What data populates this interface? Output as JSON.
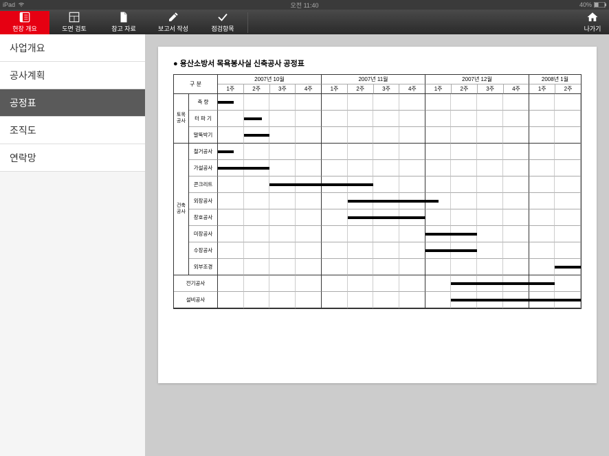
{
  "status": {
    "device": "iPad",
    "time": "오전 11:40",
    "battery": "40%"
  },
  "toolbar": {
    "items": [
      {
        "label": "현장 개요",
        "active": true
      },
      {
        "label": "도면 검토",
        "active": false
      },
      {
        "label": "참고 자료",
        "active": false
      },
      {
        "label": "보고서 작성",
        "active": false
      },
      {
        "label": "점검항목",
        "active": false
      }
    ],
    "exit": "나가기"
  },
  "sidebar": {
    "items": [
      {
        "label": "사업개요",
        "active": false
      },
      {
        "label": "공사계획",
        "active": false
      },
      {
        "label": "공정표",
        "active": true
      },
      {
        "label": "조직도",
        "active": false
      },
      {
        "label": "연락망",
        "active": false
      }
    ]
  },
  "document": {
    "title": "용산소방서 목욕봉사실 신축공사 공정표"
  },
  "chart_data": {
    "type": "gantt",
    "corner_label": "구 분",
    "months": [
      {
        "label": "2007년 10월",
        "weeks": [
          "1주",
          "2주",
          "3주",
          "4주"
        ]
      },
      {
        "label": "2007년 11월",
        "weeks": [
          "1주",
          "2주",
          "3주",
          "4주"
        ]
      },
      {
        "label": "2007년 12월",
        "weeks": [
          "1주",
          "2주",
          "3주",
          "4주"
        ]
      },
      {
        "label": "2008년 1월",
        "weeks": [
          "1주",
          "2주"
        ]
      }
    ],
    "total_weeks": 14,
    "groups": [
      {
        "category": "토목\n공사",
        "tasks": [
          {
            "label": "측  량",
            "start": 0,
            "end": 0.6
          },
          {
            "label": "터 파 기",
            "start": 1,
            "end": 1.7
          },
          {
            "label": "말뚝박기",
            "start": 1,
            "end": 2
          }
        ]
      },
      {
        "category": "건축\n공사",
        "tasks": [
          {
            "label": "철거공사",
            "start": 0,
            "end": 0.6
          },
          {
            "label": "가설공사",
            "start": 0,
            "end": 2
          },
          {
            "label": "콘크리트",
            "start": 2,
            "end": 6
          },
          {
            "label": "외장공사",
            "start": 5,
            "end": 8.5
          },
          {
            "label": "창호공사",
            "start": 5,
            "end": 8
          },
          {
            "label": "미장공사",
            "start": 8,
            "end": 10
          },
          {
            "label": "수장공사",
            "start": 8,
            "end": 10
          },
          {
            "label": "외부조경",
            "start": 13,
            "end": 14
          }
        ]
      },
      {
        "category": "",
        "tasks": [
          {
            "label": "전기공사",
            "wide": true,
            "start": 9,
            "end": 13
          },
          {
            "label": "설비공사",
            "wide": true,
            "start": 9,
            "end": 14
          }
        ]
      }
    ]
  }
}
